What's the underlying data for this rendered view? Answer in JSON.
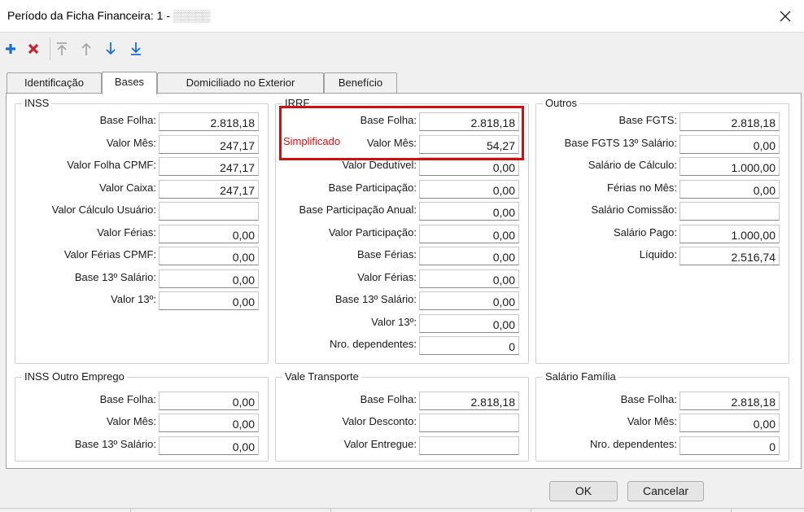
{
  "window": {
    "title": "Período da Ficha Financeira: 1 - ",
    "redacted_name": "▒▒▒▒▒",
    "close_icon": "close-icon"
  },
  "toolbar": {
    "icons": [
      "add-icon",
      "delete-icon",
      "move-first-icon",
      "move-up-icon",
      "move-down-icon",
      "move-last-icon"
    ],
    "colors": {
      "add": "#1a6fd1",
      "delete": "#c8232c",
      "disabled": "#a8a8a8",
      "arrow": "#1a6fd1"
    }
  },
  "tabs": [
    {
      "label": "Identificação",
      "active": false
    },
    {
      "label": "Bases",
      "active": true
    },
    {
      "label": "Domiciliado no Exterior",
      "active": false
    },
    {
      "label": "Benefício",
      "active": false
    }
  ],
  "groups": {
    "inss": {
      "title": "INSS",
      "rows": [
        {
          "label": "Base Folha:",
          "value": "2.818,18"
        },
        {
          "label": "Valor Mês:",
          "value": "247,17"
        },
        {
          "label": "Valor Folha CPMF:",
          "value": "247,17"
        },
        {
          "label": "Valor Caixa:",
          "value": "247,17"
        },
        {
          "label": "Valor Cálculo Usuário:",
          "value": ""
        },
        {
          "label": "Valor Férias:",
          "value": "0,00"
        },
        {
          "label": "Valor Férias CPMF:",
          "value": "0,00"
        },
        {
          "label": "Base 13º Salário:",
          "value": "0,00"
        },
        {
          "label": "Valor 13º:",
          "value": "0,00"
        }
      ]
    },
    "irrf": {
      "title": "IRRF",
      "simplificado": "Simplificado",
      "rows": [
        {
          "label": "Base Folha:",
          "value": "2.818,18"
        },
        {
          "label": "Valor Mês:",
          "value": "54,27"
        },
        {
          "label": "Valor Dedutível:",
          "value": "0,00"
        },
        {
          "label": "Base Participação:",
          "value": "0,00"
        },
        {
          "label": "Base Participação Anual:",
          "value": "0,00"
        },
        {
          "label": "Valor Participação:",
          "value": "0,00"
        },
        {
          "label": "Base Férias:",
          "value": "0,00"
        },
        {
          "label": "Valor Férias:",
          "value": "0,00"
        },
        {
          "label": "Base 13º Salário:",
          "value": "0,00"
        },
        {
          "label": "Valor 13º:",
          "value": "0,00"
        },
        {
          "label": "Nro. dependentes:",
          "value": "0"
        }
      ]
    },
    "outros": {
      "title": "Outros",
      "rows": [
        {
          "label": "Base FGTS:",
          "value": "2.818,18"
        },
        {
          "label": "Base FGTS 13º Salário:",
          "value": "0,00"
        },
        {
          "label": "Salário de Cálculo:",
          "value": "1.000,00"
        },
        {
          "label": "Férias no Mês:",
          "value": "0,00"
        },
        {
          "label": "Salário Comissão:",
          "value": ""
        },
        {
          "label": "Salário Pago:",
          "value": "1.000,00"
        },
        {
          "label": "Líquido:",
          "value": "2.516,74"
        }
      ]
    },
    "inss_outro": {
      "title": "INSS Outro Emprego",
      "rows": [
        {
          "label": "Base Folha:",
          "value": "0,00"
        },
        {
          "label": "Valor Mês:",
          "value": "0,00"
        },
        {
          "label": "Base 13º Salário:",
          "value": "0,00"
        }
      ]
    },
    "vale_transporte": {
      "title": "Vale Transporte",
      "rows": [
        {
          "label": "Base Folha:",
          "value": "2.818,18"
        },
        {
          "label": "Valor Desconto:",
          "value": ""
        },
        {
          "label": "Valor Entregue:",
          "value": ""
        }
      ]
    },
    "salario_familia": {
      "title": "Salário Família",
      "rows": [
        {
          "label": "Base Folha:",
          "value": "2.818,18"
        },
        {
          "label": "Valor Mês:",
          "value": "0,00"
        },
        {
          "label": "Nro. dependentes:",
          "value": "0"
        }
      ]
    }
  },
  "buttons": {
    "ok": "OK",
    "cancel": "Cancelar"
  },
  "highlight_color": "#d01010"
}
